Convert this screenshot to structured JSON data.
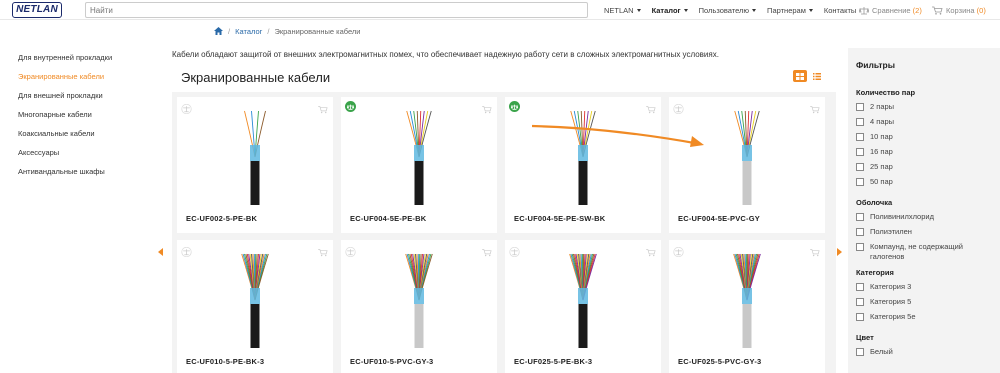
{
  "header": {
    "logo_text": "NETLAN",
    "search_placeholder": "Найти",
    "nav": [
      {
        "label": "NETLAN",
        "dropdown": true,
        "active": false
      },
      {
        "label": "Каталог",
        "dropdown": true,
        "active": true
      },
      {
        "label": "Пользователю",
        "dropdown": true,
        "active": false
      },
      {
        "label": "Партнерам",
        "dropdown": true,
        "active": false
      },
      {
        "label": "Контакты",
        "dropdown": false,
        "active": false
      }
    ],
    "compare": {
      "label": "Сравнение",
      "count": "(2)"
    },
    "cart": {
      "label": "Корзина",
      "count": "(0)"
    }
  },
  "breadcrumb": {
    "home_icon": "home-icon",
    "items": [
      "Каталог",
      "Экранированные кабели"
    ]
  },
  "sidebar": {
    "items": [
      {
        "label": "Для внутренней прокладки",
        "active": false
      },
      {
        "label": "Экранированные кабели",
        "active": true
      },
      {
        "label": "Для внешней прокладки",
        "active": false
      },
      {
        "label": "Многопарные кабели",
        "active": false
      },
      {
        "label": "Коаксиальные кабели",
        "active": false
      },
      {
        "label": "Аксессуары",
        "active": false
      },
      {
        "label": "Антивандальные шкафы",
        "active": false
      }
    ]
  },
  "main": {
    "description": "Кабели обладают защитой от внешних электромагнитных помех, что обеспечивает надежную работу сети в сложных электромагнитных условиях.",
    "title": "Экранированные кабели",
    "products": [
      {
        "name": "EC-UF002-5-PE-BK",
        "compared": false,
        "jacket": "#1a1a1a",
        "pairs": 2
      },
      {
        "name": "EC-UF004-5E-PE-BK",
        "compared": true,
        "jacket": "#1a1a1a",
        "pairs": 4
      },
      {
        "name": "EC-UF004-5E-PE-SW-BK",
        "compared": true,
        "jacket": "#1a1a1a",
        "pairs": 4
      },
      {
        "name": "EC-UF004-5E-PVC-GY",
        "compared": false,
        "jacket": "#c8c8c8",
        "pairs": 4
      },
      {
        "name": "EC-UF010-5-PE-BK-3",
        "compared": false,
        "jacket": "#1a1a1a",
        "pairs": 10
      },
      {
        "name": "EC-UF010-5-PVC-GY-3",
        "compared": false,
        "jacket": "#c8c8c8",
        "pairs": 10
      },
      {
        "name": "EC-UF025-5-PE-BK-3",
        "compared": false,
        "jacket": "#1a1a1a",
        "pairs": 25
      },
      {
        "name": "EC-UF025-5-PVC-GY-3",
        "compared": false,
        "jacket": "#c8c8c8",
        "pairs": 25
      }
    ]
  },
  "filters": {
    "title": "Фильтры",
    "groups": [
      {
        "title": "Количество пар",
        "options": [
          "2 пары",
          "4 пары",
          "10 пар",
          "16 пар",
          "25 пар",
          "50 пар"
        ]
      },
      {
        "title": "Оболочка",
        "options": [
          "Поливинилхлорид",
          "Полиэтилен",
          "Компаунд, не содержащий галогенов"
        ]
      },
      {
        "title": "Категория",
        "options": [
          "Категория 3",
          "Категория 5",
          "Категория 5e"
        ]
      },
      {
        "title": "Цвет",
        "options": [
          "Белый"
        ]
      }
    ]
  },
  "colors": {
    "accent": "#f08a24",
    "compare_active": "#3aa34a",
    "link": "#2a6aa8",
    "annotation_arrow": "#f08a24"
  }
}
